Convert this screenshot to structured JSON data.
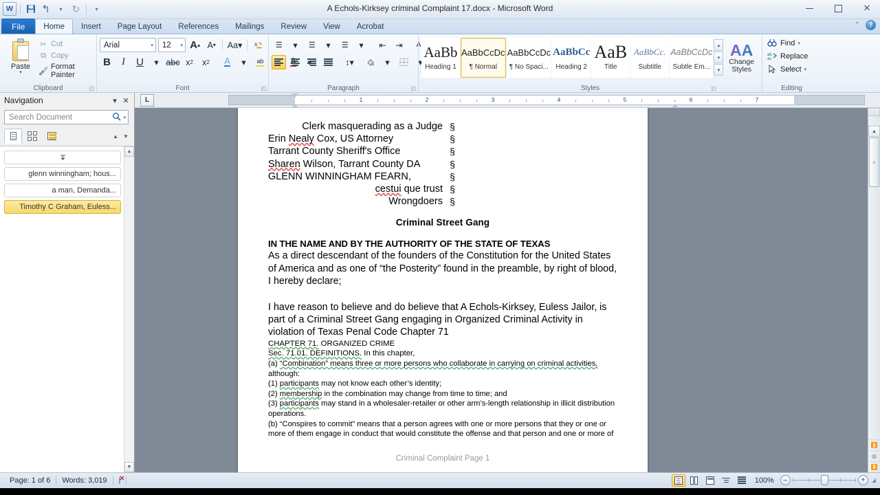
{
  "window": {
    "title": "A Echols-Kirksey criminal Complaint 17.docx  -  Microsoft Word",
    "app_icon": "W",
    "minimize": "–",
    "maximize": "□",
    "close": "✕"
  },
  "quick_access": {
    "save": "💾",
    "undo": "↰",
    "redo": "↻",
    "customize": "▾"
  },
  "tabs": [
    {
      "label": "File"
    },
    {
      "label": "Home"
    },
    {
      "label": "Insert"
    },
    {
      "label": "Page Layout"
    },
    {
      "label": "References"
    },
    {
      "label": "Mailings"
    },
    {
      "label": "Review"
    },
    {
      "label": "View"
    },
    {
      "label": "Acrobat"
    }
  ],
  "help": {
    "collapse": "⌃",
    "help": "?"
  },
  "ribbon": {
    "clipboard": {
      "group_label": "Clipboard",
      "paste": "Paste",
      "cut": "Cut",
      "copy": "Copy",
      "format_painter": "Format Painter"
    },
    "font": {
      "group_label": "Font",
      "font_name": "Arial",
      "font_size": "12",
      "grow": "A",
      "shrink": "A",
      "change_case": "Aa",
      "clear_formatting": "A",
      "bold": "B",
      "italic": "I",
      "underline": "U",
      "strikethrough": "abc",
      "subscript": "x",
      "superscript": "x",
      "text_effects": "A",
      "highlight": "ab",
      "font_color": "A"
    },
    "paragraph": {
      "group_label": "Paragraph",
      "bullets": "☰",
      "numbering": "☰",
      "multilevel": "☰",
      "decrease_indent": "⇤",
      "increase_indent": "⇥",
      "sort": "A↓",
      "show_marks": "¶",
      "align_left": "Align Left",
      "center": "Center",
      "align_right": "Align Right",
      "justify": "Justify",
      "line_spacing": "↕",
      "shading": "▦",
      "borders": "⊞"
    },
    "styles": {
      "group_label": "Styles",
      "items": [
        {
          "preview": "AaBb",
          "name": "Heading 1",
          "selected": false
        },
        {
          "preview": "AaBbCcDc",
          "name": "¶ Normal",
          "selected": true
        },
        {
          "preview": "AaBbCcDc",
          "name": "¶ No Spaci...",
          "selected": false
        },
        {
          "preview": "AaBbCc",
          "name": "Heading 2",
          "selected": false
        },
        {
          "preview": "AaB",
          "name": "Title",
          "selected": false
        },
        {
          "preview": "AaBbCc.",
          "name": "Subtitle",
          "selected": false
        },
        {
          "preview": "AaBbCcDc",
          "name": "Subtle Em...",
          "selected": false
        }
      ],
      "change_styles": "Change Styles"
    },
    "editing": {
      "group_label": "Editing",
      "find": "Find",
      "replace": "Replace",
      "select": "Select"
    }
  },
  "navigation": {
    "title": "Navigation",
    "dropdown": "▾",
    "close": "✕",
    "search_placeholder": "Search Document",
    "search_value": "",
    "results": [
      {
        "label": "",
        "selected": false,
        "is_first": true
      },
      {
        "label": "glenn winningham; hous...",
        "selected": false
      },
      {
        "label": "a man, Demanda...",
        "selected": false
      },
      {
        "label": "Timothy C Graham, Euless...",
        "selected": true
      }
    ]
  },
  "ruler": {
    "tab_selector": "L",
    "numbers": [
      "1",
      "2",
      "3",
      "4",
      "5",
      "6",
      "7"
    ]
  },
  "document": {
    "caption_rows": [
      {
        "text": "Clerk masquerading as a Judge",
        "section": "§",
        "align": "right"
      },
      {
        "text": "Erin Nealy Cox, US Attorney",
        "section": "§",
        "align": "left",
        "misspelled": "Nealy"
      },
      {
        "text": "Tarrant County Sheriff's Office",
        "section": "§",
        "align": "left"
      },
      {
        "text": "Sharen Wilson, Tarrant County DA",
        "section": "§",
        "align": "left",
        "misspelled": "Sharen"
      },
      {
        "text": "GLENN WINNINGHAM FEARN,",
        "section": "§",
        "align": "left"
      },
      {
        "text": "cestui que trust",
        "section": "§",
        "align": "right",
        "misspelled": "cestui"
      },
      {
        "text": "Wrongdoers",
        "section": "§",
        "align": "right"
      }
    ],
    "heading_center": "Criminal Street Gang",
    "heading_left": "IN THE NAME AND BY THE AUTHORITY OF THE STATE OF TEXAS",
    "para1": "As a direct descendant of the founders of the Constitution for the United States of America and as one of “the Posterity” found in the preamble, by right of blood, I hereby declare;",
    "para2": "I have reason to believe and do believe that A Echols-Kirksey, Euless Jailor, is part of a Criminal Street Gang engaging in Organized Criminal Activity in violation of Texas Penal Code Chapter 71",
    "statute_chapter": "CHAPTER 71.",
    "statute_chapter_rest": "ORGANIZED  CRIME",
    "statute_sec": "Sec. 71.01.  DEFINITIONS.",
    "statute_sec_rest": "In this chapter,",
    "stat_a_num": "(a)",
    "stat_a_under": "“Combination” means three or more persons who collaborate in carrying on criminal activities,",
    "stat_a_rest": "although:",
    "stat_1_num": "(1)",
    "stat_1_word": "participants",
    "stat_1_rest": "may not know each other’s identity;",
    "stat_2_num": "(2)",
    "stat_2_word": "membership",
    "stat_2_rest": "in the combination may change from time to time;  and",
    "stat_3_num": "(3)",
    "stat_3_word": "participants",
    "stat_3_rest": "may stand in a wholesaler-retailer  or other arm’s-length relationship in illicit distribution",
    "stat_3_cont": "operations.",
    "stat_b": "(b)  “Conspires to commit” means that a person agrees with one or more persons that they or one or",
    "stat_b_cont": "more of them engage in conduct that would constitute the offense and that person and one or more of",
    "footer": "Criminal Complaint Page 1"
  },
  "status_bar": {
    "page": "Page: 1 of 6",
    "words": "Words: 3,019",
    "proofing_icon": "proofing-errors",
    "zoom_level": "100%",
    "zoom_out": "–",
    "zoom_in": "+",
    "views": [
      {
        "name": "print-layout",
        "selected": true
      },
      {
        "name": "full-screen-reading",
        "selected": false
      },
      {
        "name": "web-layout",
        "selected": false
      },
      {
        "name": "outline",
        "selected": false
      },
      {
        "name": "draft",
        "selected": false
      }
    ]
  }
}
